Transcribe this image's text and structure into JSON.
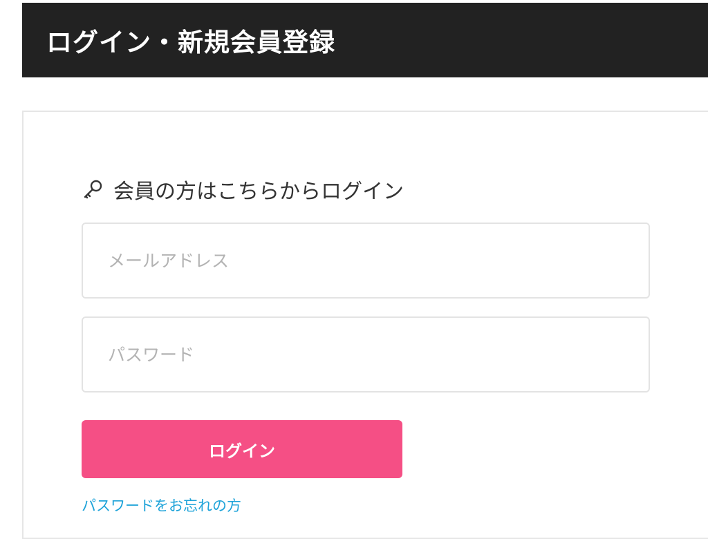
{
  "header": {
    "title": "ログイン・新規会員登録"
  },
  "login": {
    "heading": "会員の方はこちらからログイン",
    "heading_icon": "key-icon",
    "email": {
      "value": "",
      "placeholder": "メールアドレス"
    },
    "password": {
      "value": "",
      "placeholder": "パスワード"
    },
    "submit_label": "ログイン",
    "forgot_label": "パスワードをお忘れの方"
  },
  "colors": {
    "header_bg": "#222222",
    "button_bg": "#f54f85",
    "link": "#1ea3d9",
    "border": "#e3e3e3"
  }
}
